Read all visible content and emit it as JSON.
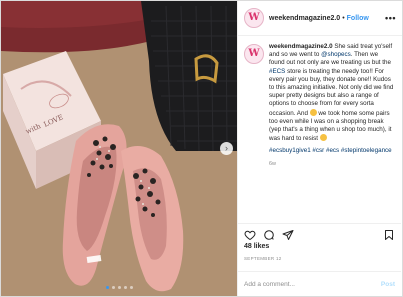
{
  "account": {
    "avatar_letter": "W",
    "username": "weekendmagazine2.0",
    "separator": "•",
    "follow_label": "Follow",
    "more_label": "•••"
  },
  "caption": {
    "username": "weekendmagazine2.0",
    "part1": " She said treat yo'self and so we went to ",
    "mention": "@shopecs",
    "part2": ". Then we found out not only are we treating us but the ",
    "hashtag_ecs": "#ECS",
    "part3": " store is treating the needy too!! For every pair you buy, they donate one!! Kudos to this amazing initiative. Not only did we find super pretty designs but also a range of options to choose from for every sorta occasion. And ",
    "part4": " we took home some pairs too even while I was on a shopping break (yep that's a thing when u shop too much), it was hard to resist ",
    "hashtags": "#ecsbuy1give1 #csr #ecs #stepintoelegance",
    "time_ago": "6w"
  },
  "engagement": {
    "likes": "48 likes",
    "date": "SEPTEMBER 12"
  },
  "comment": {
    "placeholder": "Add a comment...",
    "post_label": "Post"
  },
  "photo": {
    "box_text_1": "with",
    "box_text_2": "LOVE",
    "carousel_count": 5,
    "carousel_active": 1
  },
  "colors": {
    "link": "#00376b",
    "follow": "#3897f0",
    "post_disabled": "#b2dffc",
    "brand": "#d9336c"
  }
}
